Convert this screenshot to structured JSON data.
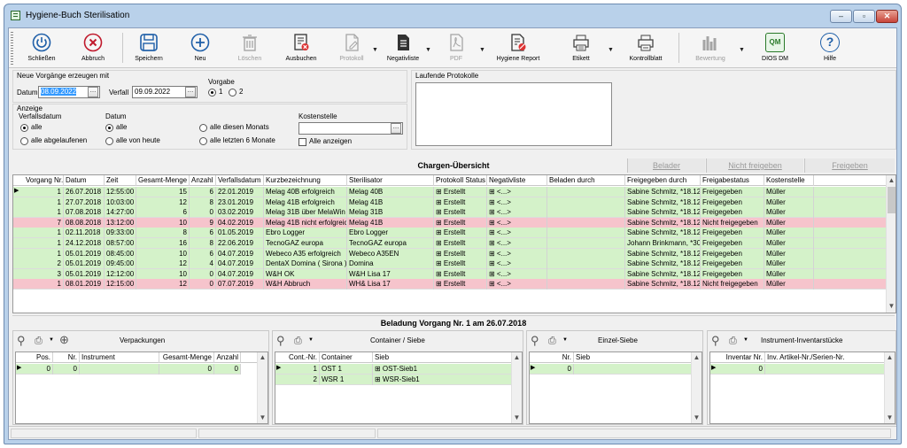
{
  "window": {
    "title": "Hygiene-Buch Sterilisation",
    "btn_min": "–",
    "btn_max": "▫",
    "btn_close": "✕"
  },
  "toolbar": [
    {
      "label": "Schließen",
      "icon": "power-icon"
    },
    {
      "label": "Abbruch",
      "icon": "cancel-icon"
    },
    {
      "label": "Speichern",
      "icon": "save-icon"
    },
    {
      "label": "Neu",
      "icon": "add-icon"
    },
    {
      "label": "Löschen",
      "icon": "trash-icon"
    },
    {
      "label": "Ausbuchen",
      "icon": "checkout-icon"
    },
    {
      "label": "Protokoll",
      "icon": "protocol-icon"
    },
    {
      "label": "Negativliste",
      "icon": "negative-list-icon"
    },
    {
      "label": "PDF",
      "icon": "pdf-icon"
    },
    {
      "label": "Hygiene Report",
      "icon": "hygiene-report-icon"
    },
    {
      "label": "Etikett",
      "icon": "label-printer-icon"
    },
    {
      "label": "Kontrollblatt",
      "icon": "control-sheet-icon"
    },
    {
      "label": "Bewertung",
      "icon": "rating-icon"
    },
    {
      "label": "DIOS DM",
      "icon": "dios-icon",
      "badge": "QM"
    },
    {
      "label": "Hilfe",
      "icon": "help-icon",
      "glyph": "?"
    }
  ],
  "neue_vorgaenge": {
    "title": "Neue Vorgänge erzeugen mit",
    "datum_label": "Datum",
    "datum_value": "08.09.2022",
    "verfall_label": "Verfall",
    "verfall_value": "09.09.2022",
    "vorgabe_label": "Vorgabe",
    "vorgabe_1": "1",
    "vorgabe_2": "2"
  },
  "anzeige": {
    "title": "Anzeige",
    "verfallsdatum_label": "Verfallsdatum",
    "opt_alle": "alle",
    "opt_abgelaufen": "alle abgelaufenen",
    "datum_label": "Datum",
    "opt_datum_alle": "alle",
    "opt_heute": "alle von heute",
    "opt_monat": "alle diesen Monats",
    "opt_6monate": "alle letzten 6 Monate",
    "kostenstelle_label": "Kostenstelle",
    "kostenstelle_value": "",
    "alle_anzeigen": "Alle anzeigen"
  },
  "laufende_protokolle": {
    "title": "Laufende Protokolle"
  },
  "chargen": {
    "title": "Chargen-Übersicht",
    "btn_belader": "Belader",
    "btn_nicht_freigeben": "Nicht freigeben",
    "btn_freigeben": "Freigeben",
    "columns": [
      "Vorgang Nr.",
      "Datum",
      "Zeit",
      "Gesamt-Menge",
      "Anzahl",
      "Verfallsdatum",
      "Kurzbezeichnung",
      "Sterilisator",
      "Protokoll Status",
      "Negativliste",
      "Beladen durch",
      "Freigegeben durch",
      "Freigabestatus",
      "Kostenstelle"
    ],
    "rows": [
      {
        "status": "ok",
        "cells": [
          "1",
          "26.07.2018",
          "12:55:00",
          "15",
          "6",
          "22.01.2019",
          "Melag 40B erfolgreich",
          "Melag 40B",
          "⊞ Erstellt",
          "⊞ <...>",
          "",
          "Sabine Schmitz, *18.12",
          "Freigegeben",
          "Müller"
        ]
      },
      {
        "status": "ok",
        "cells": [
          "1",
          "27.07.2018",
          "10:03:00",
          "12",
          "8",
          "23.01.2019",
          "Melag 41B erfolgreich",
          "Melag 41B",
          "⊞ Erstellt",
          "⊞ <...>",
          "",
          "Sabine Schmitz, *18.12",
          "Freigegeben",
          "Müller"
        ]
      },
      {
        "status": "ok",
        "cells": [
          "1",
          "07.08.2018",
          "14:27:00",
          "6",
          "0",
          "03.02.2019",
          "Melag 31B über MelaWin",
          "Melag 31B",
          "⊞ Erstellt",
          "⊞ <...>",
          "",
          "Sabine Schmitz, *18.12",
          "Freigegeben",
          "Müller"
        ]
      },
      {
        "status": "bad",
        "cells": [
          "7",
          "08.08.2018",
          "13:12:00",
          "10",
          "9",
          "04.02.2019",
          "Melag 41B nicht erfolgreich",
          "Melag 41B",
          "⊞ Erstellt",
          "⊞ <...>",
          "",
          "Sabine Schmitz, *18.12",
          "Nicht freigegeben",
          "Müller"
        ]
      },
      {
        "status": "ok",
        "cells": [
          "1",
          "02.11.2018",
          "09:33:00",
          "8",
          "6",
          "01.05.2019",
          "Ebro Logger",
          "Ebro Logger",
          "⊞ Erstellt",
          "⊞ <...>",
          "",
          "Sabine Schmitz, *18.12",
          "Freigegeben",
          "Müller"
        ]
      },
      {
        "status": "ok",
        "cells": [
          "1",
          "24.12.2018",
          "08:57:00",
          "16",
          "8",
          "22.06.2019",
          "TecnoGAZ europa",
          "TecnoGAZ europa",
          "⊞ Erstellt",
          "⊞ <...>",
          "",
          "Johann Brinkmann, *30",
          "Freigegeben",
          "Müller"
        ]
      },
      {
        "status": "ok",
        "cells": [
          "1",
          "05.01.2019",
          "08:45:00",
          "10",
          "6",
          "04.07.2019",
          "Webeco A35 erfolgreich",
          "Webeco A35EN",
          "⊞ Erstellt",
          "⊞ <...>",
          "",
          "Sabine Schmitz, *18.12",
          "Freigegeben",
          "Müller"
        ]
      },
      {
        "status": "ok",
        "cells": [
          "2",
          "05.01.2019",
          "09:45:00",
          "12",
          "4",
          "04.07.2019",
          "DentaX Domina ( Sirona )",
          "Domina",
          "⊞ Erstellt",
          "⊞ <...>",
          "",
          "Sabine Schmitz, *18.12",
          "Freigegeben",
          "Müller"
        ]
      },
      {
        "status": "ok",
        "cells": [
          "3",
          "05.01.2019",
          "12:12:00",
          "10",
          "0",
          "04.07.2019",
          "W&H OK",
          "W&H Lisa 17",
          "⊞ Erstellt",
          "⊞ <...>",
          "",
          "Sabine Schmitz, *18.12",
          "Freigegeben",
          "Müller"
        ]
      },
      {
        "status": "bad",
        "cells": [
          "1",
          "08.01.2019",
          "12:15:00",
          "12",
          "0",
          "07.07.2019",
          "W&H Abbruch",
          "WH& Lisa 17",
          "⊞ Erstellt",
          "⊞ <...>",
          "",
          "Sabine Schmitz, *18.12",
          "Nicht freigegeben",
          "Müller"
        ]
      }
    ]
  },
  "beladung": {
    "title": "Beladung Vorgang Nr. 1 am 26.07.2018"
  },
  "panels": [
    {
      "label": "Verpackungen",
      "columns": [
        "Pos.",
        "Nr.",
        "Instrument",
        "Gesamt-Menge",
        "Anzahl"
      ],
      "rows": [
        [
          "0",
          "0",
          "",
          "0",
          "0"
        ]
      ]
    },
    {
      "label": "Container / Siebe",
      "columns": [
        "Cont.-Nr.",
        "Container",
        "Sieb"
      ],
      "rows": [
        [
          "1",
          "OST 1",
          "⊞ OST-Sieb1"
        ],
        [
          "2",
          "WSR 1",
          "⊞ WSR-Sieb1"
        ]
      ]
    },
    {
      "label": "Einzel-Siebe",
      "columns": [
        "Nr.",
        "Sieb"
      ],
      "rows": [
        [
          "0",
          ""
        ]
      ]
    },
    {
      "label": "Instrument-Inventarstücke",
      "columns": [
        "Inventar Nr.",
        "Inv. Artikel-Nr./Serien-Nr."
      ],
      "rows": [
        [
          "0",
          ""
        ]
      ]
    }
  ],
  "colors": {
    "ok_row": "#d4f2c9",
    "bad_row": "#f6c4cc",
    "selection": "#3399ff"
  }
}
